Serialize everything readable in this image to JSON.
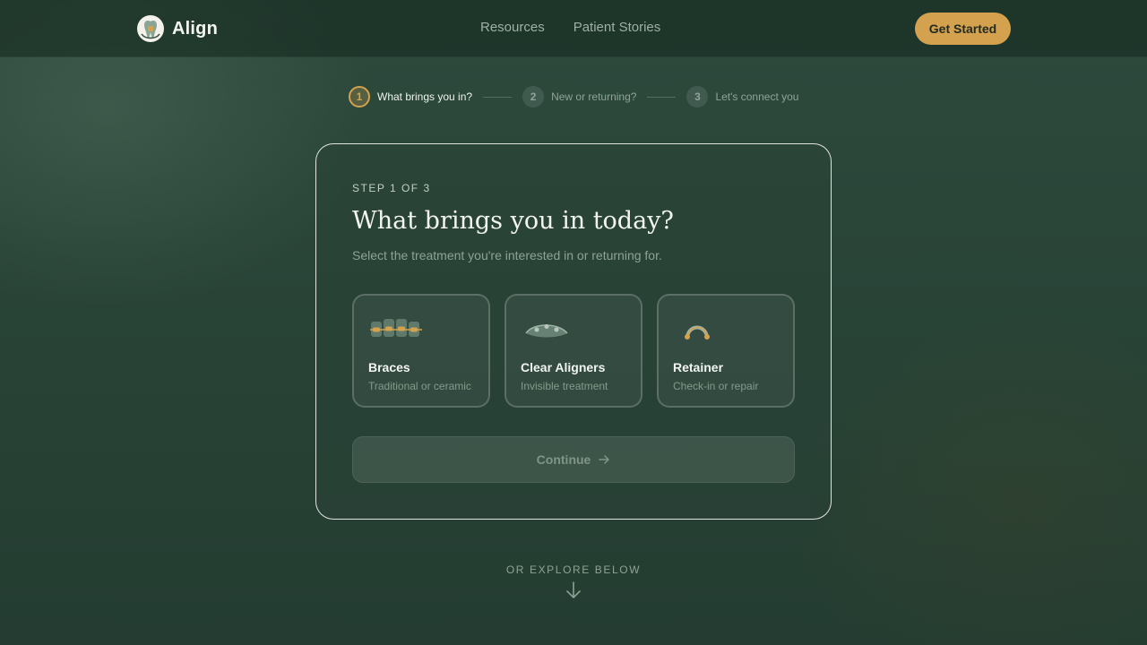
{
  "brand": {
    "name": "Align",
    "logo_icon": "tooth-icon"
  },
  "nav": {
    "items": [
      {
        "label": "Resources"
      },
      {
        "label": "Patient Stories"
      }
    ]
  },
  "header": {
    "cta_label": "Get Started"
  },
  "stepper": {
    "steps": [
      {
        "number": "1",
        "label": "What brings you in?",
        "active": true
      },
      {
        "number": "2",
        "label": "New or returning?",
        "active": false
      },
      {
        "number": "3",
        "label": "Let's connect you",
        "active": false
      }
    ]
  },
  "card": {
    "eyebrow": "STEP 1 OF 3",
    "title": "What brings you in today?",
    "subtitle": "Select the treatment you're interested in or returning for.",
    "options": [
      {
        "title": "Braces",
        "subtitle": "Traditional or ceramic",
        "icon": "braces-icon"
      },
      {
        "title": "Clear Aligners",
        "subtitle": "Invisible treatment",
        "icon": "aligner-icon"
      },
      {
        "title": "Retainer",
        "subtitle": "Check-in or repair",
        "icon": "retainer-icon"
      }
    ],
    "continue_label": "Continue"
  },
  "explore": {
    "label": "OR EXPLORE BELOW"
  },
  "colors": {
    "accent": "#d4a24e",
    "background": "#284336"
  }
}
